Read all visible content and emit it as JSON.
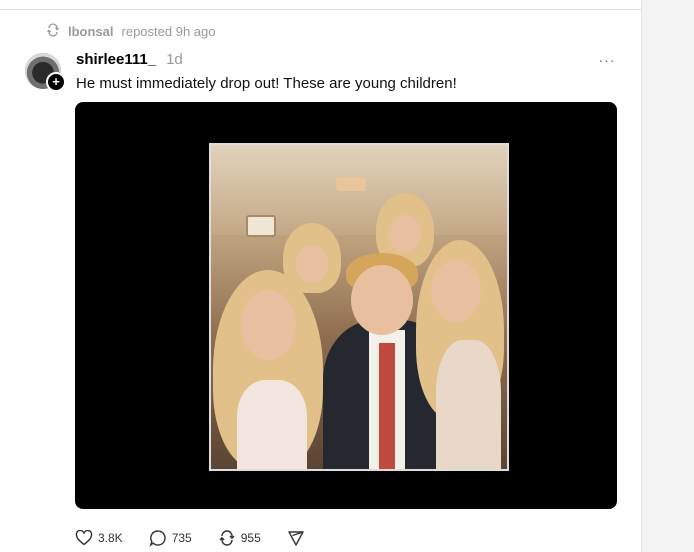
{
  "repost": {
    "user": "lbonsal",
    "text": "reposted 9h ago"
  },
  "post": {
    "author": "shirlee111_",
    "time": "1d",
    "more_label": "···",
    "text": "He must immediately drop out! These are young children!"
  },
  "actions": {
    "likes": "3.8K",
    "comments": "735",
    "reposts": "955"
  },
  "colors": {
    "muted": "#999999",
    "media_bg": "#000000",
    "text": "#000000"
  },
  "icons": [
    "repost-icon",
    "plus-icon",
    "more-icon",
    "heart-icon",
    "comment-icon",
    "share-icon",
    "send-icon"
  ]
}
